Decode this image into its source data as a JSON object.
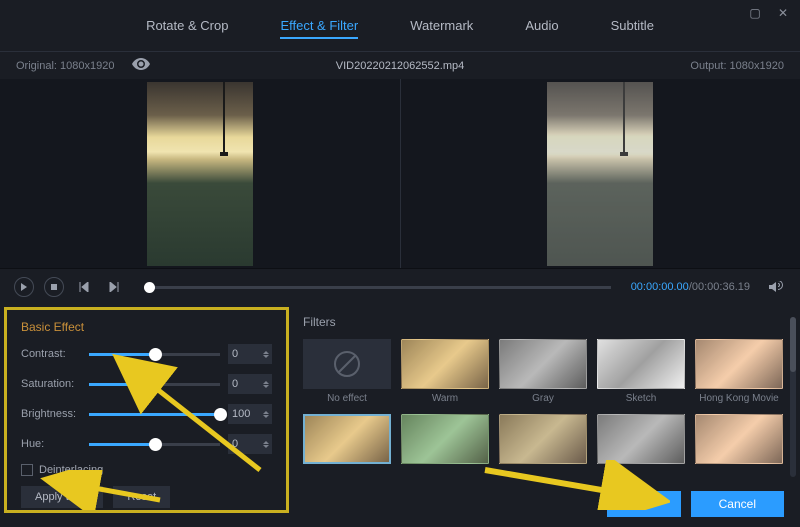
{
  "window": {
    "maximize_icon": "▢",
    "close_icon": "✕"
  },
  "tabs": {
    "rotate": "Rotate & Crop",
    "effect": "Effect & Filter",
    "watermark": "Watermark",
    "audio": "Audio",
    "subtitle": "Subtitle"
  },
  "info": {
    "original_label": "Original: 1080x1920",
    "filename": "VID20220212062552.mp4",
    "output_label": "Output: 1080x1920"
  },
  "playback": {
    "time_current": "00:00:00.00",
    "time_sep": "/",
    "time_total": "00:00:36.19"
  },
  "basic_effect": {
    "title": "Basic Effect",
    "contrast": {
      "label": "Contrast:",
      "value": "0",
      "pct": 50
    },
    "saturation": {
      "label": "Saturation:",
      "value": "0",
      "pct": 50
    },
    "brightness": {
      "label": "Brightness:",
      "value": "100",
      "pct": 100
    },
    "hue": {
      "label": "Hue:",
      "value": "0",
      "pct": 50
    },
    "deinterlacing": "Deinterlacing",
    "apply_all": "Apply to All",
    "reset": "Reset"
  },
  "filters": {
    "title": "Filters",
    "items": [
      {
        "label": "No effect"
      },
      {
        "label": "Warm"
      },
      {
        "label": "Gray"
      },
      {
        "label": "Sketch"
      },
      {
        "label": "Hong Kong Movie"
      }
    ]
  },
  "footer": {
    "ok": "OK",
    "cancel": "Cancel"
  }
}
